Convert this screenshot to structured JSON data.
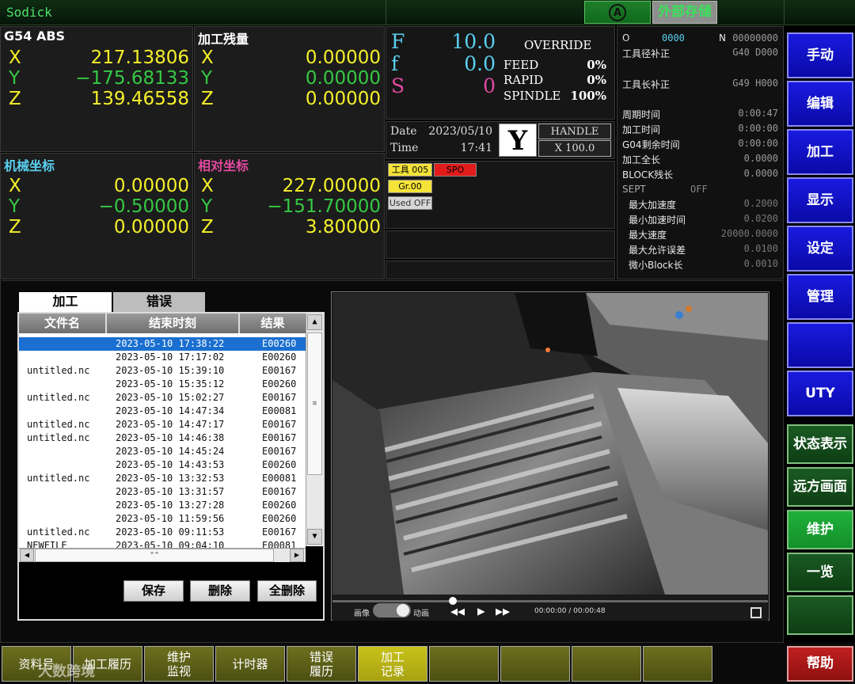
{
  "topbar": {
    "brand": "Sodick",
    "auto_label": "A",
    "external_storage": "外部存储"
  },
  "coords": {
    "g54": {
      "title": "G54 ABS",
      "x": "217.13806",
      "y": "−175.68133",
      "z": "139.46558"
    },
    "remaining": {
      "title": "加工残量",
      "x": "0.00000",
      "y": "0.00000",
      "z": "0.00000"
    },
    "machine": {
      "title": "机械坐标",
      "x": "0.00000",
      "y": "−0.50000",
      "z": "0.00000"
    },
    "relative": {
      "title": "相对坐标",
      "x": "227.00000",
      "y": "−151.70000",
      "z": "3.80000"
    },
    "labels": {
      "x": "X",
      "y": "Y",
      "z": "Z"
    }
  },
  "feed": {
    "F_label": "F",
    "F_value": "10.0",
    "f_label": "f",
    "f_value": "0.0",
    "S_label": "S",
    "S_value": "0",
    "override_title": "OVERRIDE",
    "feed_label": "FEED",
    "feed_value": "0%",
    "rapid_label": "RAPID",
    "rapid_value": "0%",
    "spindle_label": "SPINDLE",
    "spindle_value": "100%"
  },
  "datetime": {
    "date_label": "Date",
    "date_value": "2023/05/10",
    "time_label": "Time",
    "time_value": "17:41",
    "axis": "Y",
    "handle_label": "HANDLE",
    "handle_value": "X 100.0"
  },
  "tags": {
    "tool": "工具 005",
    "spo": "SPO",
    "gr": "Gr.00",
    "used": "Used OFF"
  },
  "info": {
    "o_label": "O",
    "o_value": "0000",
    "n_label": "N",
    "n_value": "00000000",
    "radius_label": "工具径补正",
    "radius_value": "G40 D000",
    "length_label": "工具长补正",
    "length_value": "G49 H000",
    "rows": [
      {
        "label": "周期时间",
        "value": "0:00:47"
      },
      {
        "label": "加工时间",
        "value": "0:00:00"
      },
      {
        "label": "G04剩余时间",
        "value": "0:00:00"
      },
      {
        "label": "加工全长",
        "value": "0.0000"
      },
      {
        "label": "BLOCK残长",
        "value": "0.0000"
      }
    ],
    "sept_label": "SEPT",
    "sept_value": "OFF",
    "sept_rows": [
      {
        "label": "最大加速度",
        "value": "0.2000"
      },
      {
        "label": "最小加速时间",
        "value": "0.0200"
      },
      {
        "label": "最大速度",
        "value": "20000.0000"
      },
      {
        "label": "最大允许误差",
        "value": "0.0100"
      },
      {
        "label": "微小Block长",
        "value": "0.0010"
      }
    ]
  },
  "right_buttons": [
    "手动",
    "编辑",
    "加工",
    "显示",
    "设定",
    "管理",
    "",
    "UTY"
  ],
  "right_green_buttons": [
    "状态表示",
    "远方画面",
    "维护",
    "一览",
    ""
  ],
  "help": "帮助",
  "bottom_buttons": [
    "资料号",
    "加工履历",
    "维护\n监视",
    "计时器",
    "错误\n履历",
    "加工\n记录",
    "",
    "",
    "",
    ""
  ],
  "watermark": "大数跨境",
  "history": {
    "tabs": [
      "加工",
      "错误"
    ],
    "headers": [
      "文件名",
      "结束时刻",
      "结果"
    ],
    "rows": [
      {
        "file": "",
        "time": "2023-05-10 17:38:22",
        "result": "E00260"
      },
      {
        "file": "",
        "time": "2023-05-10 17:17:02",
        "result": "E00260"
      },
      {
        "file": "untitled.nc",
        "time": "2023-05-10 15:39:10",
        "result": "E00167"
      },
      {
        "file": "",
        "time": "2023-05-10 15:35:12",
        "result": "E00260"
      },
      {
        "file": "untitled.nc",
        "time": "2023-05-10 15:02:27",
        "result": "E00167"
      },
      {
        "file": "",
        "time": "2023-05-10 14:47:34",
        "result": "E00081"
      },
      {
        "file": "untitled.nc",
        "time": "2023-05-10 14:47:17",
        "result": "E00167"
      },
      {
        "file": "untitled.nc",
        "time": "2023-05-10 14:46:38",
        "result": "E00167"
      },
      {
        "file": "",
        "time": "2023-05-10 14:45:24",
        "result": "E00167"
      },
      {
        "file": "",
        "time": "2023-05-10 14:43:53",
        "result": "E00260"
      },
      {
        "file": "untitled.nc",
        "time": "2023-05-10 13:32:53",
        "result": "E00081"
      },
      {
        "file": "",
        "time": "2023-05-10 13:31:57",
        "result": "E00167"
      },
      {
        "file": "",
        "time": "2023-05-10 13:27:28",
        "result": "E00260"
      },
      {
        "file": "",
        "time": "2023-05-10 11:59:56",
        "result": "E00260"
      },
      {
        "file": "untitled.nc",
        "time": "2023-05-10 09:11:53",
        "result": "E00167"
      },
      {
        "file": "NEWFILE",
        "time": "2023-05-10 09:04:10",
        "result": "E00081"
      }
    ],
    "hscroll_label": "\"\"",
    "save": "保存",
    "delete": "删除",
    "delete_all": "全删除"
  },
  "video": {
    "mode_left": "画像",
    "mode_right": "动画",
    "time": "00:00:00 / 00:00:48"
  },
  "colors": {
    "accent_yellow": "#f5f02a",
    "accent_green": "#35c944",
    "accent_cyan": "#5ad0f0",
    "accent_magenta": "#e04aa0",
    "button_blue": "#1a1ae0"
  }
}
